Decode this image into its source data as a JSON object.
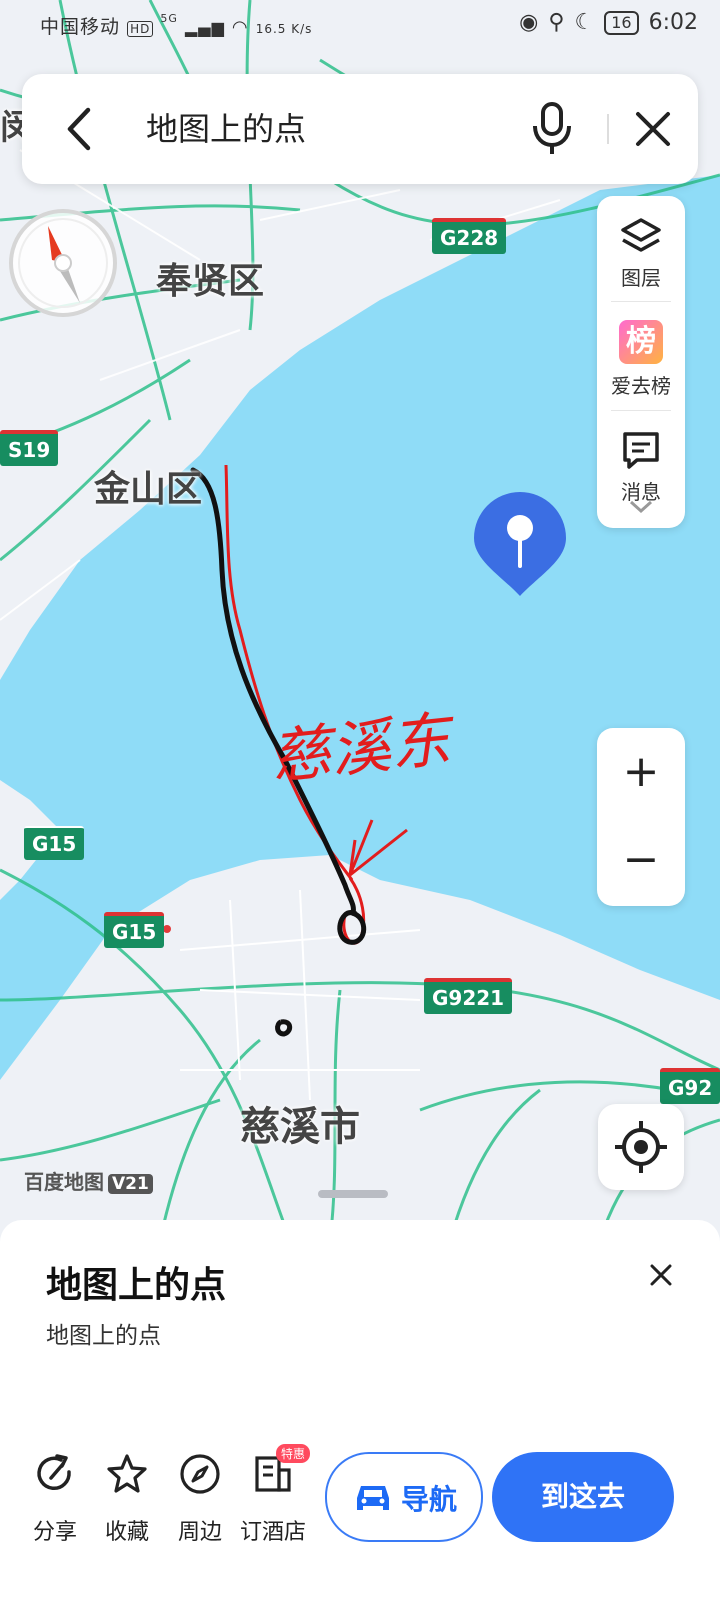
{
  "status_bar": {
    "carrier": "中国移动",
    "hd": "HD",
    "signal": "5G",
    "speed": "16.5 K/s",
    "battery": "16",
    "time": "6:02"
  },
  "search": {
    "query": "地图上的点"
  },
  "map": {
    "labels": {
      "fengxian": "奉贤区",
      "jinshan": "金山区",
      "cixi": "慈溪市",
      "top_left": "闵"
    },
    "shields": {
      "g228": "G228",
      "s19": "S19",
      "g15_a": "G15",
      "g15_b": "G15",
      "g9221": "G9221",
      "g92": "G92"
    },
    "annotation_text": "慈溪东",
    "watermark": "百度地图",
    "watermark_version": "V21"
  },
  "right_panel": {
    "layers": "图层",
    "ranking": "爱去榜",
    "ranking_badge": "榜",
    "message": "消息"
  },
  "zoom": {
    "in": "+",
    "out": "−"
  },
  "card": {
    "title": "地图上的点",
    "subtitle": "地图上的点"
  },
  "actions": {
    "share": "分享",
    "favorite": "收藏",
    "nearby": "周边",
    "hotel": "订酒店",
    "hotel_badge": "特惠",
    "navigate": "导航",
    "go_here": "到这去"
  },
  "colors": {
    "water": "#8fdcf7",
    "land": "#eef1f6",
    "road": "#2fc08c",
    "accent": "#2f73f6",
    "annotation_red": "#e21d1d"
  }
}
